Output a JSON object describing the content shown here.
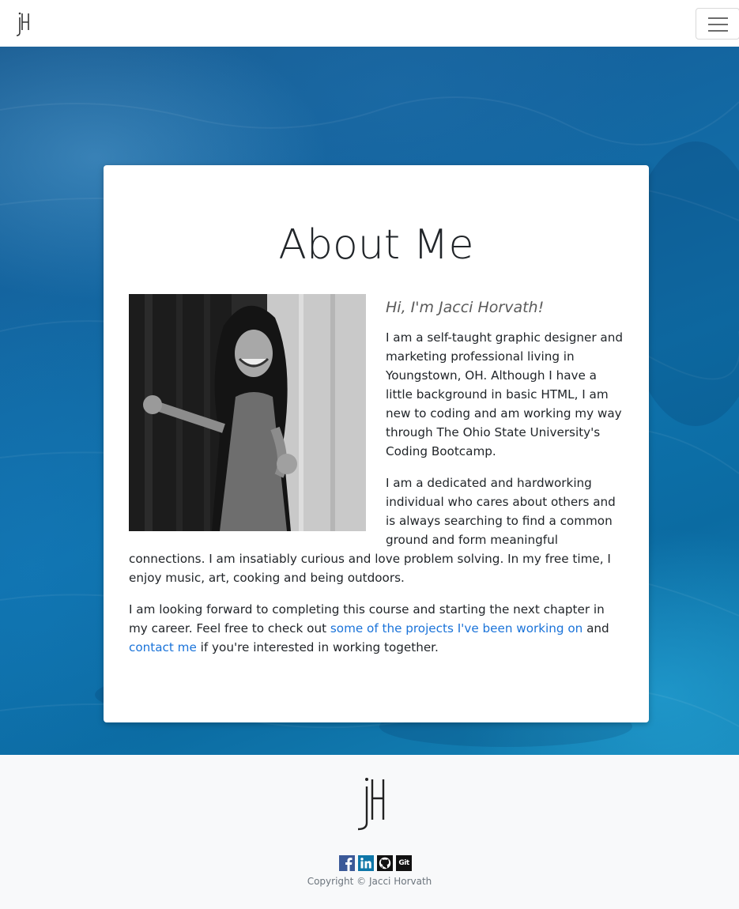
{
  "nav": {
    "logo_icon": "jh-monogram-icon",
    "toggler_icon": "hamburger-menu-icon"
  },
  "about": {
    "heading": "About Me",
    "greeting": "Hi, I'm Jacci Horvath!",
    "paragraph1": "I am a self-taught graphic designer and marketing professional living in Youngstown, OH. Although I have a little background in basic HTML, I am new to coding and am working my way through The Ohio State University's Coding Bootcamp.",
    "paragraph2": "I am a dedicated and hardworking individual who cares about others and is always searching to find a common ground and form meaningful connections. I am insatiably curious and love problem solving. In my free time, I enjoy music, art, cooking and being outdoors.",
    "paragraph3_part1": "I am looking forward to completing this course and starting the next chapter in my career. Feel free to check out ",
    "projects_link": "some of the projects I've been working on",
    "paragraph3_part2": " and ",
    "contact_link": "contact me",
    "paragraph3_part3": " if you're interested in working together.",
    "photo_icon": "profile-photo"
  },
  "footer": {
    "logo_icon": "jh-monogram-icon",
    "social": [
      {
        "name": "facebook-icon",
        "color": "#3b5998"
      },
      {
        "name": "linkedin-icon",
        "color": "#0e76a8"
      },
      {
        "name": "github-icon",
        "color": "#111111"
      },
      {
        "name": "git-icon",
        "color": "#111111",
        "label": "Git"
      }
    ],
    "copyright": "Copyright © Jacci Horvath"
  },
  "colors": {
    "link": "#1a73d9",
    "footer_bg": "#f8f9fa",
    "ocean": "#0f73ad"
  }
}
